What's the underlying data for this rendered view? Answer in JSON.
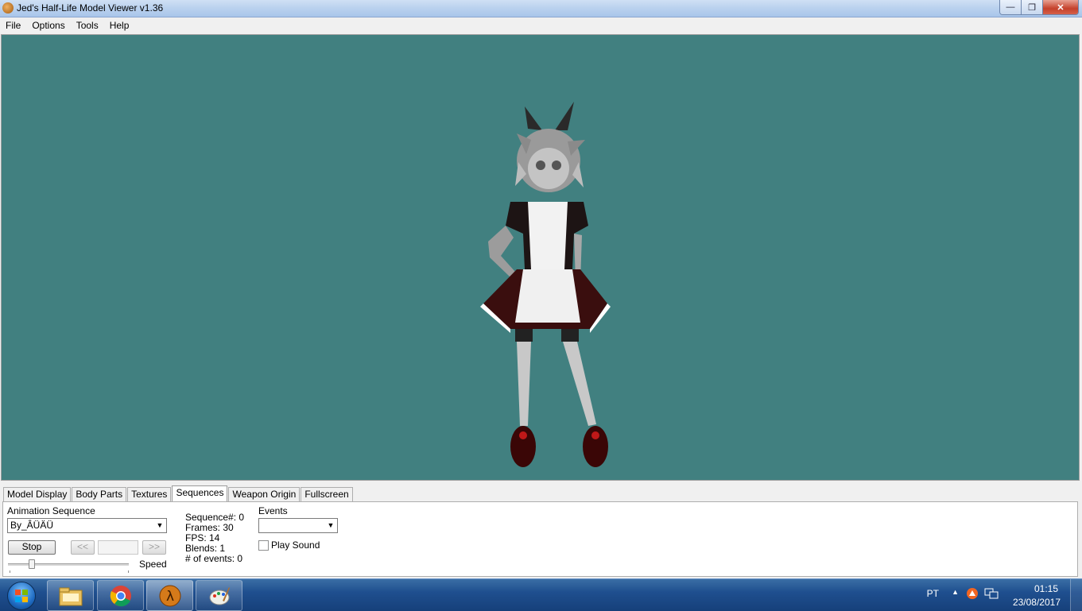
{
  "window": {
    "title": "Jed's Half-Life Model Viewer v1.36",
    "controls": {
      "minimize": "—",
      "maximize": "❐",
      "close": "✕"
    }
  },
  "menu": [
    "File",
    "Options",
    "Tools",
    "Help"
  ],
  "viewport": {
    "background_color": "#418080"
  },
  "tabs": [
    "Model Display",
    "Body Parts",
    "Textures",
    "Sequences",
    "Weapon Origin",
    "Fullscreen"
  ],
  "active_tab": "Sequences",
  "sequences": {
    "animation_label": "Animation Sequence",
    "animation_value": "By_ÂÜÄÜ",
    "stop_label": "Stop",
    "prev_label": "<<",
    "next_label": ">>",
    "speed_label": "Speed",
    "speed_value_fraction": 0.2,
    "info": {
      "sequence": "Sequence#: 0",
      "frames": "Frames: 30",
      "fps": "FPS: 14",
      "blends": "Blends: 1",
      "events": "# of events: 0"
    },
    "events_label": "Events",
    "events_value": "",
    "play_sound_label": "Play Sound",
    "play_sound_checked": false
  },
  "taskbar": {
    "apps": [
      "windows-explorer-icon",
      "chrome-icon",
      "half-life-icon",
      "paint-icon"
    ],
    "language": "PT",
    "time": "01:15",
    "date": "23/08/2017"
  }
}
